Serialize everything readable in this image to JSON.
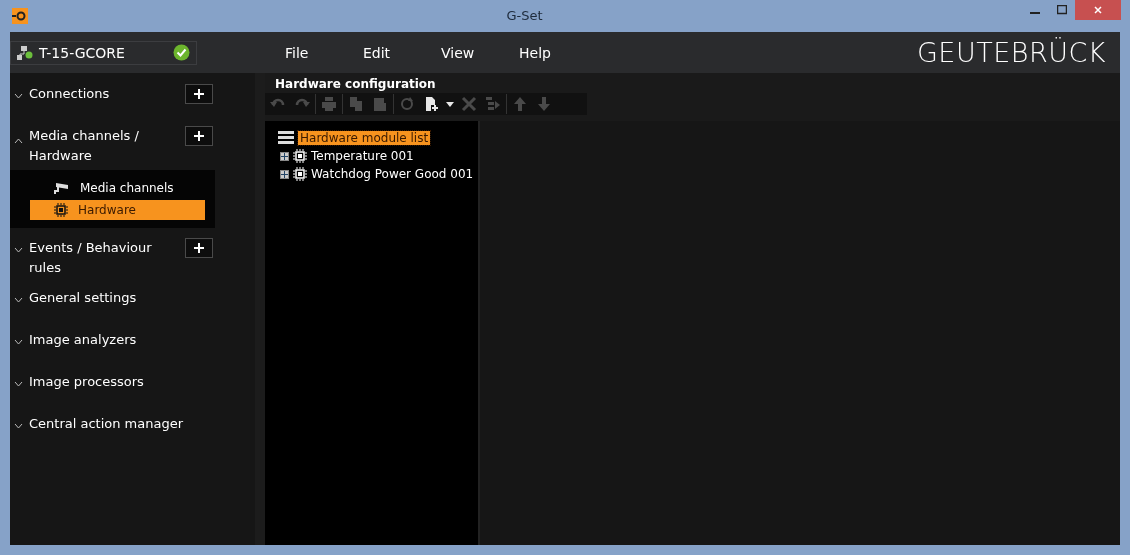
{
  "window": {
    "title": "G-Set"
  },
  "connection": {
    "name": "T-15-GCORE",
    "connected": true
  },
  "menu": [
    "File",
    "Edit",
    "View",
    "Help"
  ],
  "logo": "GEUTEBRÜCK",
  "sidebar": {
    "sections": [
      {
        "label": "Connections",
        "expanded": false,
        "can_add": true
      },
      {
        "label": "Media channels / Hardware",
        "expanded": true,
        "can_add": true,
        "children": [
          {
            "label": "Media channels",
            "kind": "camera",
            "selected": false
          },
          {
            "label": "Hardware",
            "kind": "chip",
            "selected": true
          }
        ]
      },
      {
        "label": "Events / Behaviour rules",
        "expanded": false,
        "can_add": true
      },
      {
        "label": "General settings",
        "expanded": false,
        "can_add": false
      },
      {
        "label": "Image analyzers",
        "expanded": false,
        "can_add": false
      },
      {
        "label": "Image processors",
        "expanded": false,
        "can_add": false
      },
      {
        "label": "Central action manager",
        "expanded": false,
        "can_add": false
      }
    ]
  },
  "panel": {
    "title": "Hardware configuration",
    "toolbar": [
      {
        "kind": "undo",
        "disabled": true
      },
      {
        "kind": "redo",
        "disabled": true
      },
      {
        "kind": "sep"
      },
      {
        "kind": "print",
        "disabled": true
      },
      {
        "kind": "sep"
      },
      {
        "kind": "copy",
        "disabled": true
      },
      {
        "kind": "paste",
        "disabled": true
      },
      {
        "kind": "sep"
      },
      {
        "kind": "refresh",
        "disabled": true
      },
      {
        "kind": "add",
        "disabled": false
      },
      {
        "kind": "dropdown",
        "disabled": false
      },
      {
        "kind": "delete",
        "disabled": true
      },
      {
        "kind": "properties",
        "disabled": true
      },
      {
        "kind": "sep"
      },
      {
        "kind": "up",
        "disabled": true
      },
      {
        "kind": "down",
        "disabled": true
      }
    ],
    "tree": {
      "label": "Hardware module list",
      "selected": true,
      "children": [
        {
          "label": "Temperature 001",
          "expanded": false,
          "selected": false
        },
        {
          "label": "Watchdog Power Good 001",
          "expanded": false,
          "selected": false
        }
      ]
    }
  }
}
